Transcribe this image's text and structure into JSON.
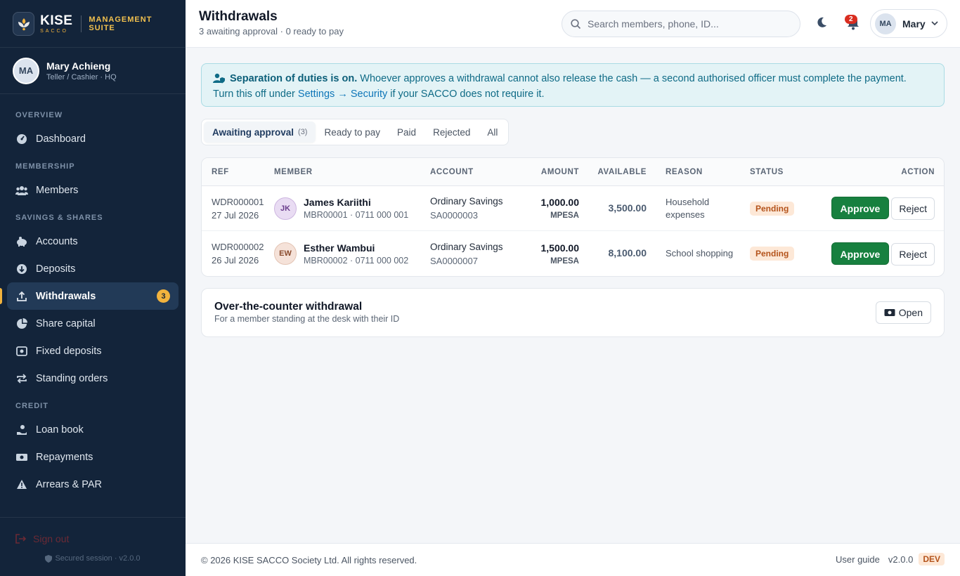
{
  "brand": {
    "name": "KISE",
    "sub": "SACCO",
    "tag": "MANAGEMENT SUITE"
  },
  "user": {
    "initials": "MA",
    "name": "Mary Achieng",
    "role": "Teller / Cashier · HQ",
    "short_name": "Mary"
  },
  "nav": {
    "sections": {
      "overview": "OVERVIEW",
      "membership": "MEMBERSHIP",
      "savings": "SAVINGS & SHARES",
      "credit": "CREDIT"
    },
    "items": {
      "dashboard": "Dashboard",
      "members": "Members",
      "accounts": "Accounts",
      "deposits": "Deposits",
      "withdrawals": "Withdrawals",
      "withdrawals_badge": "3",
      "share_capital": "Share capital",
      "fixed_deposits": "Fixed deposits",
      "standing_orders": "Standing orders",
      "loan_book": "Loan book",
      "repayments": "Repayments",
      "arrears": "Arrears & PAR"
    },
    "signout": "Sign out",
    "secured": "Secured session · v2.0.0"
  },
  "header": {
    "title": "Withdrawals",
    "subtitle": "3 awaiting approval · 0 ready to pay",
    "search_placeholder": "Search members, phone, ID...",
    "notifications": "2"
  },
  "notice": {
    "bold": "Separation of duties is on.",
    "text1": " Whoever approves a withdrawal cannot also release the cash — a second authorised officer must complete the payment.",
    "text2": "Turn this off under ",
    "link": "Settings → Security",
    "text3": " if your SACCO does not require it."
  },
  "tabs": {
    "awaiting": "Awaiting approval",
    "awaiting_count": "(3)",
    "ready": "Ready to pay",
    "paid": "Paid",
    "rejected": "Rejected",
    "all": "All"
  },
  "table": {
    "headers": {
      "ref": "REF",
      "member": "MEMBER",
      "account": "ACCOUNT",
      "amount": "AMOUNT",
      "available": "AVAILABLE",
      "reason": "REASON",
      "status": "STATUS",
      "action": "ACTION"
    },
    "rows": [
      {
        "ref": "WDR000001",
        "date": "27 Jul 2026",
        "initials": "JK",
        "name": "James Kariithi",
        "member_sub": "MBR00001 · 0711 000 001",
        "account": "Ordinary Savings",
        "account_no": "SA0000003",
        "amount": "1,000.00",
        "channel": "MPESA",
        "available": "3,500.00",
        "reason": "Household expenses",
        "status": "Pending",
        "approve": "Approve",
        "reject": "Reject"
      },
      {
        "ref": "WDR000002",
        "date": "26 Jul 2026",
        "initials": "EW",
        "name": "Esther Wambui",
        "member_sub": "MBR00002 · 0711 000 002",
        "account": "Ordinary Savings",
        "account_no": "SA0000007",
        "amount": "1,500.00",
        "channel": "MPESA",
        "available": "8,100.00",
        "reason": "School shopping",
        "status": "Pending",
        "approve": "Approve",
        "reject": "Reject"
      }
    ]
  },
  "otc": {
    "title": "Over-the-counter withdrawal",
    "subtitle": "For a member standing at the desk with their ID",
    "open": "Open"
  },
  "footer": {
    "copyright": "© 2026 KISE SACCO Society Ltd. All rights reserved.",
    "guide": "User guide",
    "version": "v2.0.0",
    "env": "DEV"
  },
  "colors": {
    "sidebar": "#13243a",
    "accent": "#f2b33d",
    "approve": "#17803f",
    "pending": "#b4531b",
    "info": "#0f6b86"
  }
}
